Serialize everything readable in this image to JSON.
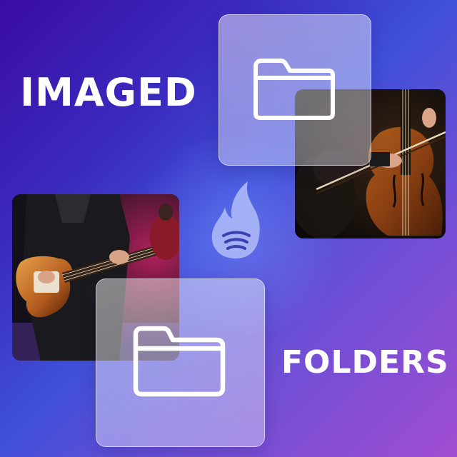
{
  "headline": {
    "top_text": "IMAGED",
    "bottom_text": "FOLDERS"
  },
  "colors": {
    "background_start": "#3a0ca3",
    "background_mid": "#3f4fd8",
    "background_end": "#a04dd1",
    "headline_text": "#ffffff",
    "folder_stroke": "#ffffff",
    "logo_fill": "#a9b4f5"
  },
  "icons": {
    "folder_top": "folder-icon",
    "folder_bottom": "folder-icon",
    "logo": "flame-signal-logo"
  },
  "photos": {
    "top_right": "cello-player-photo",
    "bottom_left": "electric-guitar-player-photo"
  }
}
